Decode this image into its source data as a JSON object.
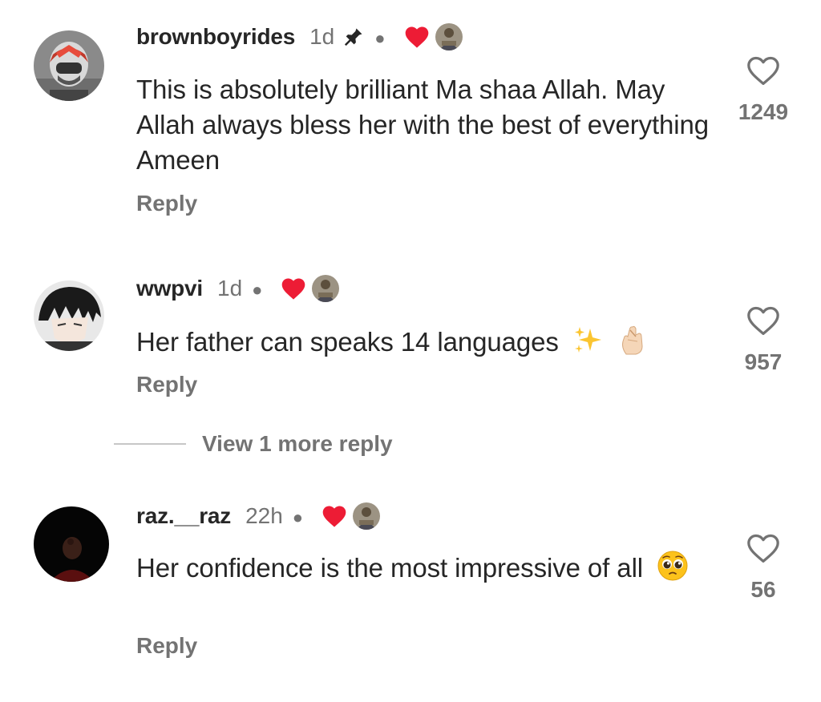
{
  "colors": {
    "text": "#262626",
    "muted": "#737373",
    "heart": "#ed4956",
    "divider": "#c7c7c7"
  },
  "comments": [
    {
      "username": "brownboyrides",
      "time": "1d",
      "pinned": true,
      "liked_by_creator": true,
      "text": "This is absolutely brilliant Ma shaa Allah. May Allah always bless her with the best of everything Ameen",
      "reply_label": "Reply",
      "likes": "1249"
    },
    {
      "username": "wwpvi",
      "time": "1d",
      "pinned": false,
      "liked_by_creator": true,
      "text": "Her father can speaks 14 languages",
      "reply_label": "Reply",
      "likes": "957"
    },
    {
      "username": "raz.__raz",
      "time": "22h",
      "pinned": false,
      "liked_by_creator": true,
      "text": "Her confidence is the most impressive of all",
      "reply_label": "Reply",
      "likes": "56"
    }
  ],
  "view_more_replies": "View 1 more reply",
  "icons": {
    "pin": "pin-icon",
    "creator_heart": "creator-liked-heart-icon",
    "like": "heart-outline-icon",
    "sparkles": "sparkles-emoji",
    "fingers_crossed": "crossed-fingers-emoji",
    "pleading": "pleading-face-emoji"
  }
}
